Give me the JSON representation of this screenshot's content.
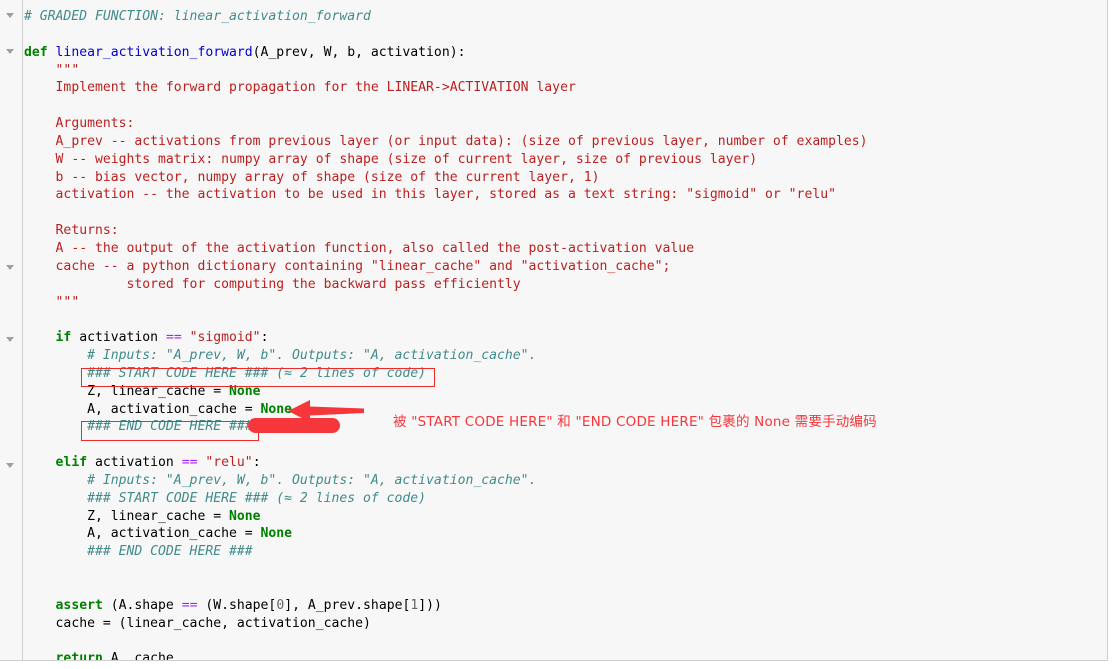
{
  "editor": {
    "language": "python",
    "background_color": "#f7f7f7",
    "gutter_fold_marker": "chevron-down-icon",
    "fold_marker_tops": [
      11,
      47,
      263,
      335,
      461
    ]
  },
  "theme": {
    "comment_color": "#418b8b",
    "keyword_color": "#008000",
    "function_color": "#0000cf",
    "string_color": "#ba2121",
    "operator_color": "#aa22ff",
    "builtin_color": "#008000",
    "number_color": "#666666",
    "plain_color": "#000000",
    "annotation_color": "#ee2b2b"
  },
  "code": {
    "lines": [
      {
        "id": "l01",
        "indent": 0,
        "tokens": [
          {
            "t": "cm",
            "v": "# GRADED FUNCTION: linear_activation_forward"
          }
        ]
      },
      {
        "id": "l02",
        "indent": 0,
        "tokens": []
      },
      {
        "id": "l03",
        "indent": 0,
        "tokens": [
          {
            "t": "kw",
            "v": "def"
          },
          {
            "t": "pl",
            "v": " "
          },
          {
            "t": "fn",
            "v": "linear_activation_forward"
          },
          {
            "t": "pl",
            "v": "(A_prev, W, b, activation):"
          }
        ]
      },
      {
        "id": "l04",
        "indent": 1,
        "tokens": [
          {
            "t": "str",
            "v": "\"\"\""
          }
        ]
      },
      {
        "id": "l05",
        "indent": 1,
        "tokens": [
          {
            "t": "str",
            "v": "Implement the forward propagation for the LINEAR->ACTIVATION layer"
          }
        ]
      },
      {
        "id": "l06",
        "indent": 0,
        "tokens": []
      },
      {
        "id": "l07",
        "indent": 1,
        "tokens": [
          {
            "t": "str",
            "v": "Arguments:"
          }
        ]
      },
      {
        "id": "l08",
        "indent": 1,
        "tokens": [
          {
            "t": "str",
            "v": "A_prev -- activations from previous layer (or input data): (size of previous layer, number of examples)"
          }
        ]
      },
      {
        "id": "l09",
        "indent": 1,
        "tokens": [
          {
            "t": "str",
            "v": "W -- weights matrix: numpy array of shape (size of current layer, size of previous layer)"
          }
        ]
      },
      {
        "id": "l10",
        "indent": 1,
        "tokens": [
          {
            "t": "str",
            "v": "b -- bias vector, numpy array of shape (size of the current layer, 1)"
          }
        ]
      },
      {
        "id": "l11",
        "indent": 1,
        "tokens": [
          {
            "t": "str",
            "v": "activation -- the activation to be used in this layer, stored as a text string: \"sigmoid\" or \"relu\""
          }
        ]
      },
      {
        "id": "l12",
        "indent": 0,
        "tokens": []
      },
      {
        "id": "l13",
        "indent": 1,
        "tokens": [
          {
            "t": "str",
            "v": "Returns:"
          }
        ]
      },
      {
        "id": "l14",
        "indent": 1,
        "tokens": [
          {
            "t": "str",
            "v": "A -- the output of the activation function, also called the post-activation value"
          }
        ]
      },
      {
        "id": "l15",
        "indent": 1,
        "tokens": [
          {
            "t": "str",
            "v": "cache -- a python dictionary containing \"linear_cache\" and \"activation_cache\";"
          }
        ]
      },
      {
        "id": "l16",
        "indent": 2,
        "tokens": [
          {
            "t": "str",
            "v": "     stored for computing the backward pass efficiently"
          }
        ]
      },
      {
        "id": "l17",
        "indent": 1,
        "tokens": [
          {
            "t": "str",
            "v": "\"\"\""
          }
        ]
      },
      {
        "id": "l18",
        "indent": 0,
        "tokens": []
      },
      {
        "id": "l19",
        "indent": 1,
        "tokens": [
          {
            "t": "kw",
            "v": "if"
          },
          {
            "t": "pl",
            "v": " activation "
          },
          {
            "t": "op",
            "v": "=="
          },
          {
            "t": "pl",
            "v": " "
          },
          {
            "t": "str",
            "v": "\"sigmoid\""
          },
          {
            "t": "pl",
            "v": ":"
          }
        ]
      },
      {
        "id": "l20",
        "indent": 2,
        "tokens": [
          {
            "t": "cm",
            "v": "# Inputs: \"A_prev, W, b\". Outputs: \"A, activation_cache\"."
          }
        ]
      },
      {
        "id": "l21",
        "indent": 2,
        "tokens": [
          {
            "t": "cm",
            "v": "### START CODE HERE ### (≈ 2 lines of code)"
          }
        ]
      },
      {
        "id": "l22",
        "indent": 2,
        "tokens": [
          {
            "t": "pl",
            "v": "Z, linear_cache = "
          },
          {
            "t": "bi",
            "v": "None"
          }
        ]
      },
      {
        "id": "l23",
        "indent": 2,
        "tokens": [
          {
            "t": "pl",
            "v": "A, activation_cache = "
          },
          {
            "t": "bi",
            "v": "None"
          }
        ]
      },
      {
        "id": "l24",
        "indent": 2,
        "tokens": [
          {
            "t": "cm",
            "v": "### END CODE HERE ###"
          }
        ]
      },
      {
        "id": "l25",
        "indent": 0,
        "tokens": []
      },
      {
        "id": "l26",
        "indent": 1,
        "tokens": [
          {
            "t": "kw",
            "v": "elif"
          },
          {
            "t": "pl",
            "v": " activation "
          },
          {
            "t": "op",
            "v": "=="
          },
          {
            "t": "pl",
            "v": " "
          },
          {
            "t": "str",
            "v": "\"relu\""
          },
          {
            "t": "pl",
            "v": ":"
          }
        ]
      },
      {
        "id": "l27",
        "indent": 2,
        "tokens": [
          {
            "t": "cm",
            "v": "# Inputs: \"A_prev, W, b\". Outputs: \"A, activation_cache\"."
          }
        ]
      },
      {
        "id": "l28",
        "indent": 2,
        "tokens": [
          {
            "t": "cm",
            "v": "### START CODE HERE ### (≈ 2 lines of code)"
          }
        ]
      },
      {
        "id": "l29",
        "indent": 2,
        "tokens": [
          {
            "t": "pl",
            "v": "Z, linear_cache = "
          },
          {
            "t": "bi",
            "v": "None"
          }
        ]
      },
      {
        "id": "l30",
        "indent": 2,
        "tokens": [
          {
            "t": "pl",
            "v": "A, activation_cache = "
          },
          {
            "t": "bi",
            "v": "None"
          }
        ]
      },
      {
        "id": "l31",
        "indent": 2,
        "tokens": [
          {
            "t": "cm",
            "v": "### END CODE HERE ###"
          }
        ]
      },
      {
        "id": "l32",
        "indent": 0,
        "tokens": []
      },
      {
        "id": "l33",
        "indent": 0,
        "tokens": []
      },
      {
        "id": "l34",
        "indent": 1,
        "tokens": [
          {
            "t": "kw",
            "v": "assert"
          },
          {
            "t": "pl",
            "v": " (A.shape "
          },
          {
            "t": "op",
            "v": "=="
          },
          {
            "t": "pl",
            "v": " (W.shape["
          },
          {
            "t": "num",
            "v": "0"
          },
          {
            "t": "pl",
            "v": "], A_prev.shape["
          },
          {
            "t": "num",
            "v": "1"
          },
          {
            "t": "pl",
            "v": "]))"
          }
        ]
      },
      {
        "id": "l35",
        "indent": 1,
        "tokens": [
          {
            "t": "pl",
            "v": "cache = (linear_cache, activation_cache)"
          }
        ]
      },
      {
        "id": "l36",
        "indent": 0,
        "tokens": []
      },
      {
        "id": "l37",
        "indent": 1,
        "tokens": [
          {
            "t": "kw",
            "v": "return"
          },
          {
            "t": "pl",
            "v": " A, cache"
          }
        ]
      }
    ]
  },
  "annotations": {
    "start_code_box_label": "### START CODE HERE ### (≈ 2 lines of code)",
    "end_code_box_label": "### END CODE HERE ###",
    "arrow": "left-arrow-icon",
    "note": "被 \"START CODE HERE\" 和 \"END CODE HERE\" 包裹的 None 需要手动编码"
  }
}
